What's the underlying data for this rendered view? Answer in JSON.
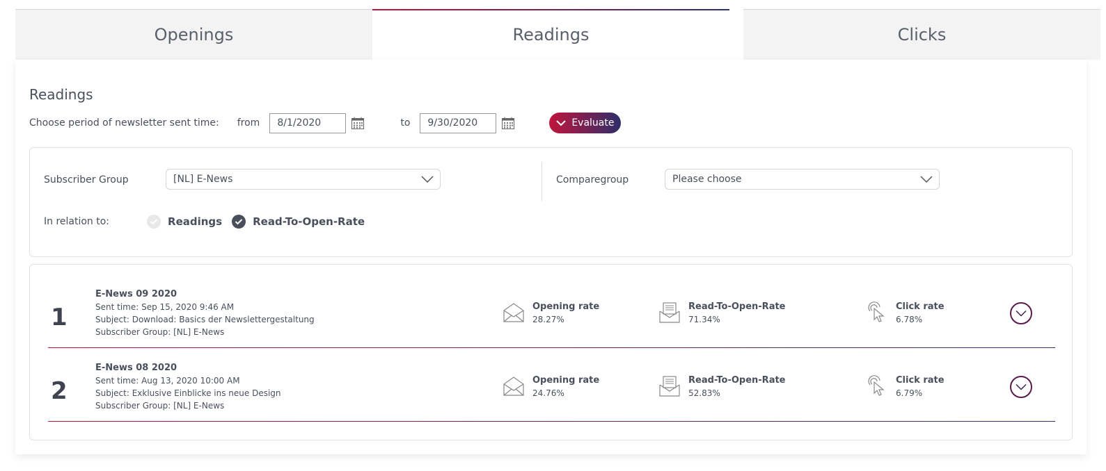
{
  "tabs": [
    {
      "label": "Openings",
      "active": false
    },
    {
      "label": "Readings",
      "active": true
    },
    {
      "label": "Clicks",
      "active": false
    }
  ],
  "section_title": "Readings",
  "period": {
    "label": "Choose period of newsletter sent time:",
    "from_label": "from",
    "from_value": "8/1/2020",
    "to_label": "to",
    "to_value": "9/30/2020",
    "evaluate_label": "Evaluate"
  },
  "filters": {
    "subscriber_group_label": "Subscriber Group",
    "subscriber_group_value": "[NL] E-News",
    "comparegroup_label": "Comparegroup",
    "comparegroup_value": "Please choose",
    "relation_label": "In relation to:",
    "options": [
      {
        "label": "Readings",
        "checked": false
      },
      {
        "label": "Read-To-Open-Rate",
        "checked": true
      }
    ]
  },
  "results": [
    {
      "rank": "1",
      "title": "E-News 09 2020",
      "sent_time": "Sent time: Sep 15, 2020 9:46 AM",
      "subject": "Subject: Download: Basics der Newslettergestaltung",
      "group": "Subscriber Group: [NL] E-News",
      "opening_label": "Opening rate",
      "opening_value": "28.27%",
      "rtor_label": "Read-To-Open-Rate",
      "rtor_value": "71.34%",
      "click_label": "Click rate",
      "click_value": "6.78%"
    },
    {
      "rank": "2",
      "title": "E-News 08 2020",
      "sent_time": "Sent time: Aug 13, 2020 10:00 AM",
      "subject": "Subject: Exklusive Einblicke ins neue Design",
      "group": "Subscriber Group: [NL] E-News",
      "opening_label": "Opening rate",
      "opening_value": "24.76%",
      "rtor_label": "Read-To-Open-Rate",
      "rtor_value": "52.83%",
      "click_label": "Click rate",
      "click_value": "6.79%"
    }
  ],
  "colors": {
    "accent_start": "#c0143c",
    "accent_end": "#2d2f6b"
  }
}
